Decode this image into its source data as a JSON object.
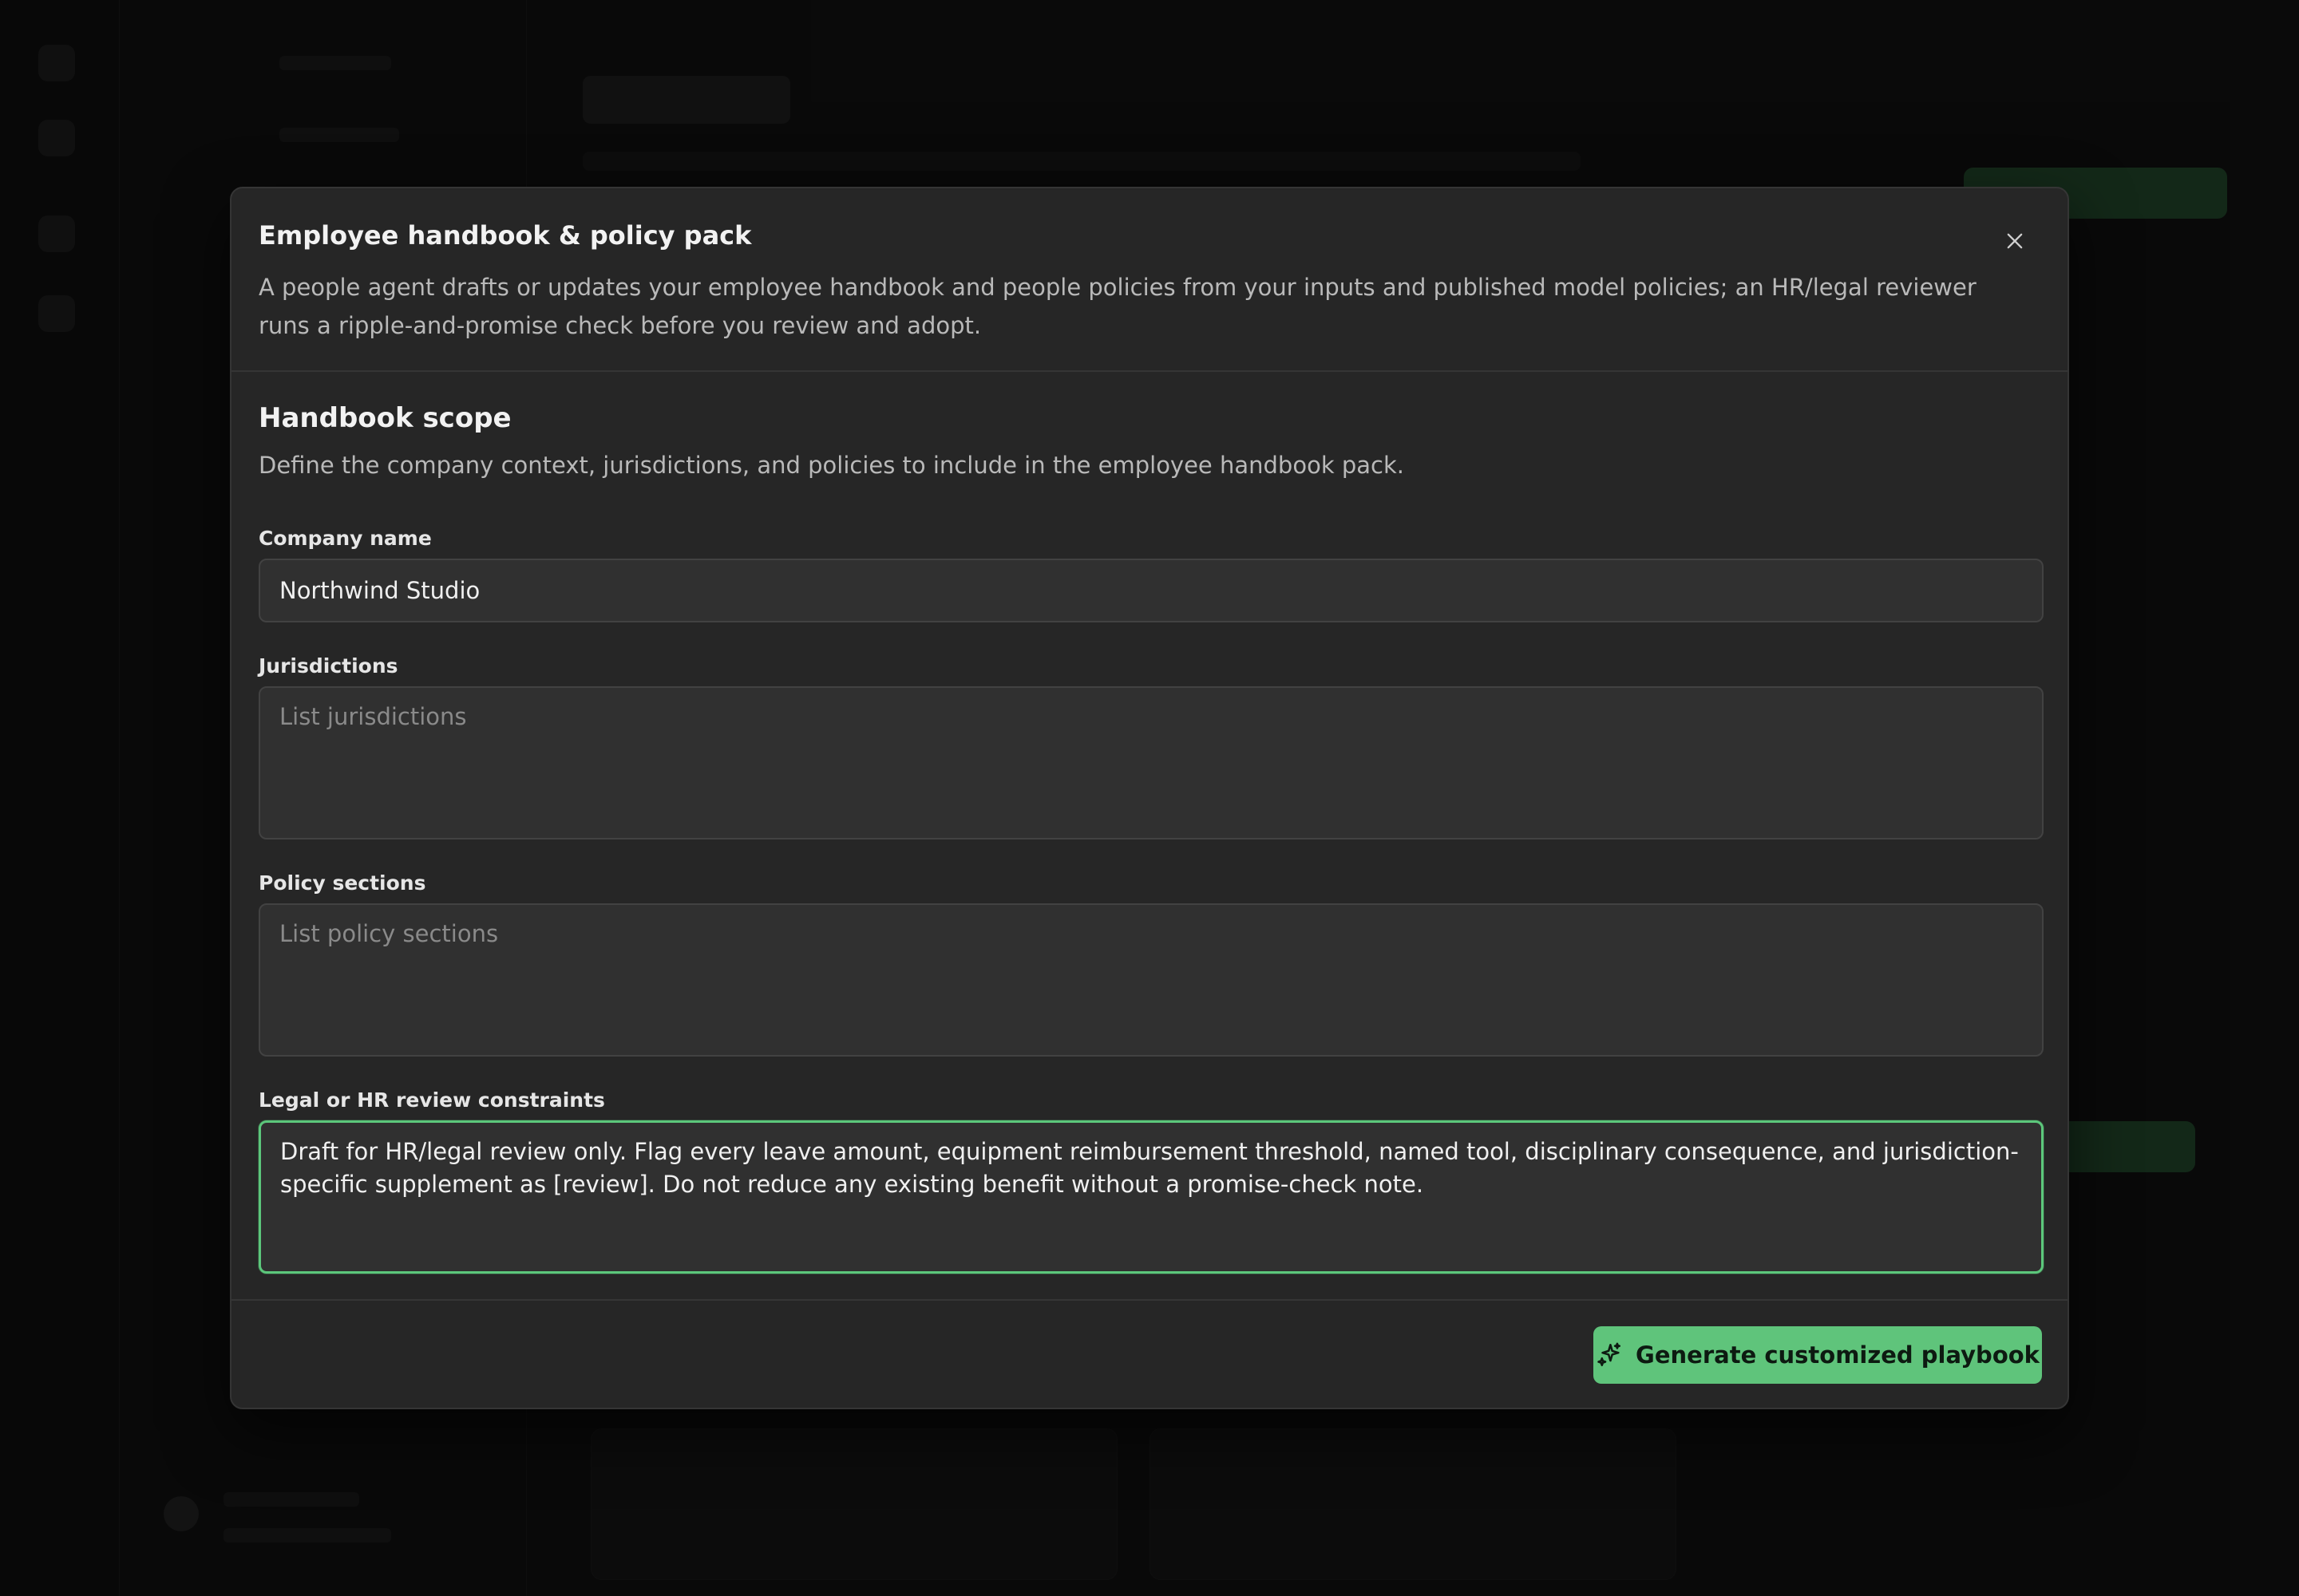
{
  "modal": {
    "title": "Employee handbook & policy pack",
    "description": "A people agent drafts or updates your employee handbook and people policies from your inputs and published model policies; an HR/legal reviewer runs a ripple-and-promise check before you review and adopt.",
    "close_icon": "close-icon"
  },
  "section": {
    "title": "Handbook scope",
    "description": "Define the company context, jurisdictions, and policies to include in the employee handbook pack."
  },
  "fields": {
    "company_name": {
      "label": "Company name",
      "value": "Northwind Studio"
    },
    "jurisdictions": {
      "label": "Jurisdictions",
      "placeholder": "List jurisdictions",
      "value": ""
    },
    "policy_sections": {
      "label": "Policy sections",
      "placeholder": "List policy sections",
      "value": ""
    },
    "constraints": {
      "label": "Legal or HR review constraints",
      "value": "Draft for HR/legal review only. Flag every leave amount, equipment reimbursement threshold, named tool, disciplinary consequence, and jurisdiction-specific supplement as [review]. Do not reduce any existing benefit without a promise-check note."
    }
  },
  "footer": {
    "generate_label": "Generate customized playbook",
    "generate_icon": "sparkles-icon"
  },
  "colors": {
    "accent": "#5fc47b",
    "modal_bg": "#262626",
    "field_bg": "#303030"
  }
}
